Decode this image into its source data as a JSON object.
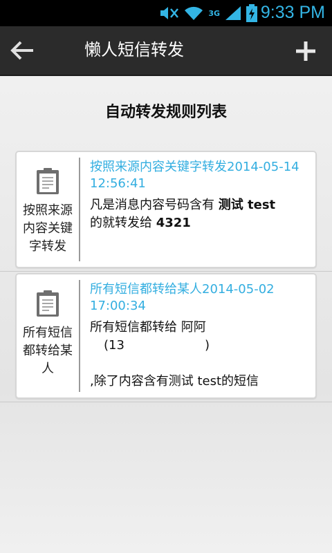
{
  "status_bar": {
    "time": "9:33 PM",
    "network": "3G"
  },
  "action_bar": {
    "title": "懒人短信转发"
  },
  "page": {
    "heading": "自动转发规则列表"
  },
  "rules": [
    {
      "type_label": "按照来源内容关键字转发",
      "title": "按照来源内容关键字转发2014-05-14 12:56:41",
      "desc_prefix": "凡是消息内容号码含有 ",
      "keyword": "测试 test",
      "desc_mid": "的就转发给 ",
      "target": "4321"
    },
    {
      "type_label": "所有短信都转给某人",
      "title": "所有短信都转给某人2014-05-02 17:00:34",
      "desc_line1": "所有短信都转给 阿阿",
      "desc_line2": "(13",
      "desc_line2_end": ")",
      "desc_line3": ",除了内容含有测试 test的短信"
    }
  ],
  "colors": {
    "accent": "#33b5e5",
    "action_bar": "#2b2b2b"
  },
  "icons": [
    "back-arrow-icon",
    "add-icon",
    "clipboard-icon",
    "wifi-icon",
    "signal-icon",
    "battery-icon"
  ]
}
